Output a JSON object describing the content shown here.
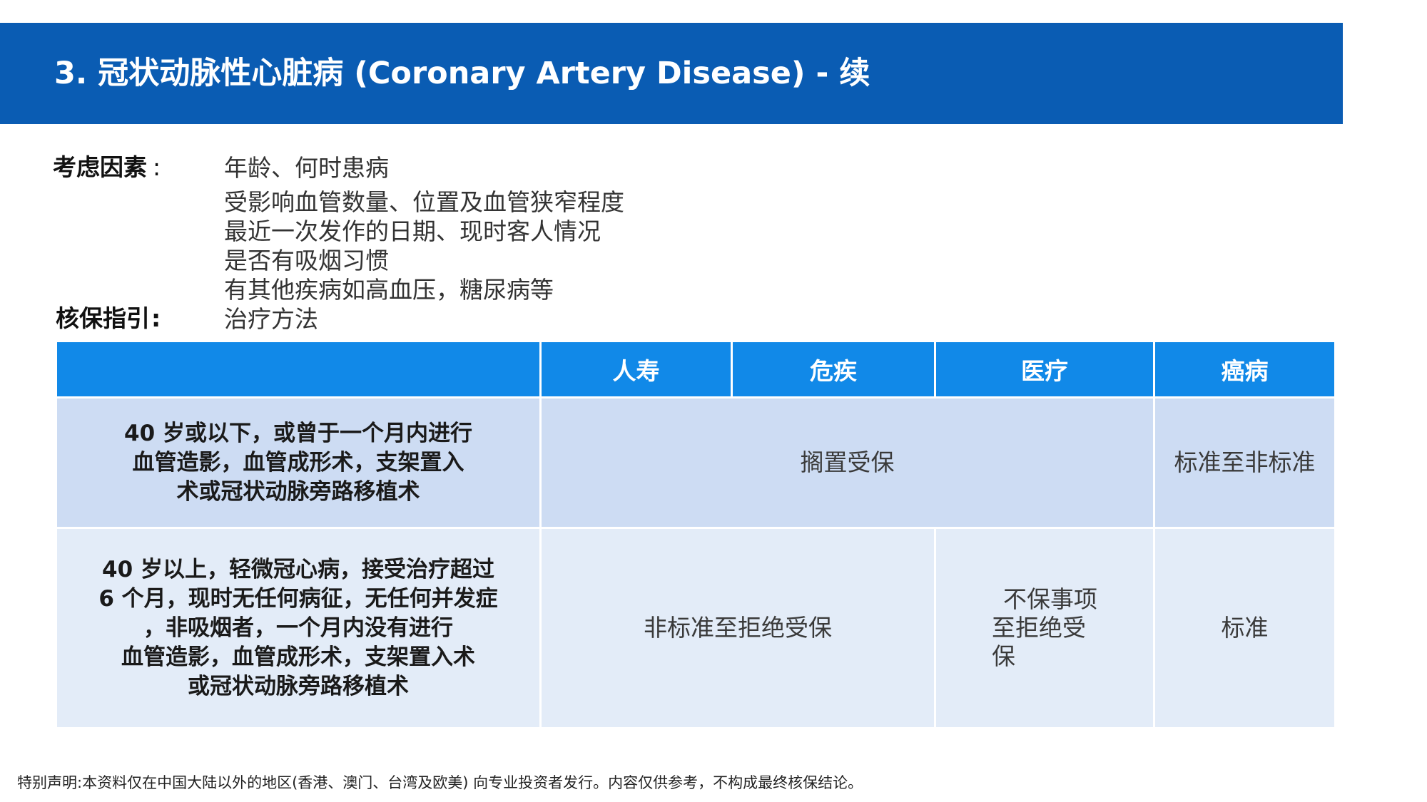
{
  "header": {
    "title": "3. 冠状动脉性心脏病 (Coronary  Artery  Disease)  - 续"
  },
  "factors": {
    "label": "考虑因素",
    "separator": ":",
    "items": [
      "年龄、何时患病",
      "受影响血管数量、位置及血管狭窄程度",
      "最近一次发作的日期、现时客人情况",
      "是否有吸烟习惯",
      "有其他疾病如高血压，糖尿病等",
      "治疗方法"
    ]
  },
  "guideline": {
    "label": "核保指引",
    "separator": ":"
  },
  "table": {
    "headers": [
      "",
      "人寿",
      "危疾",
      "医疗",
      "癌病"
    ],
    "rows": [
      {
        "condition_lines": [
          "40 岁或以下，或曾于一个月内进行",
          "血管造影，血管成形术，支架置入",
          "术或冠状动脉旁路移植术"
        ],
        "life_critical_medical": "搁置受保",
        "cancer": "标准至非标准"
      },
      {
        "condition_lines": [
          "40 岁以上，轻微冠心病，接受治疗超过",
          "6 个月，现时无任何病征，无任何并发症",
          "，非吸烟者，一个月内没有进行",
          "血管造影，血管成形术，支架置入术",
          "或冠状动脉旁路移植术"
        ],
        "life_critical": "非标准至拒绝受保",
        "medical_lines": [
          "不保事项",
          "至拒绝受",
          "保"
        ],
        "cancer": "标准"
      }
    ]
  },
  "footer": {
    "disclaimer": "特别声明:本资料仅在中国大陆以外的地区(香港、澳门、台湾及欧美) 向专业投资者发行。内容仅供参考，不构成最终核保结论。"
  },
  "colors": {
    "title_bar": "#0a5cb3",
    "table_header": "#1189e8",
    "row1": "#cddcf3",
    "row2": "#e3ecf8"
  }
}
